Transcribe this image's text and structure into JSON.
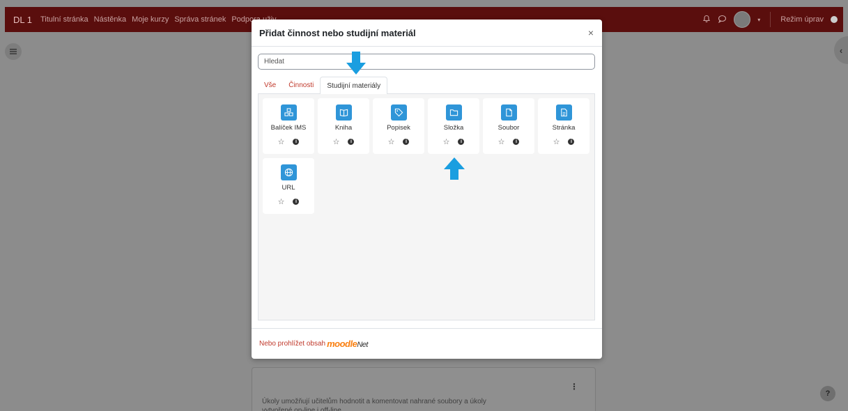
{
  "navbar": {
    "brand": "DL 1",
    "links": [
      "Titulní stránka",
      "Nástěnka",
      "Moje kurzy",
      "Správa stránek",
      "Podpora uživ"
    ],
    "edit_mode_label": "Režim úprav"
  },
  "modal": {
    "title": "Přidat činnost nebo studijní materiál",
    "close": "×",
    "search_placeholder": "Hledat",
    "tabs": [
      "Vše",
      "Činnosti",
      "Studijní materiály"
    ],
    "active_tab": "Studijní materiály",
    "tiles": [
      {
        "label": "Balíček IMS",
        "icon": "package-icon"
      },
      {
        "label": "Kniha",
        "icon": "book-icon"
      },
      {
        "label": "Popisek",
        "icon": "tag-icon"
      },
      {
        "label": "Složka",
        "icon": "folder-icon"
      },
      {
        "label": "Soubor",
        "icon": "file-icon"
      },
      {
        "label": "Stránka",
        "icon": "page-icon"
      },
      {
        "label": "URL",
        "icon": "globe-icon"
      }
    ],
    "footer_text": "Nebo prohlížet obsah",
    "footer_logo_moodle": "moodle",
    "footer_logo_net": "Net"
  },
  "background_card": {
    "text": "Úkoly umožňují učitelům hodnotit a komentovat nahrané soubory a úkoly vytvořené on-line i off-line"
  },
  "colors": {
    "accent": "#2f95d8",
    "navbar": "#5a0e0d",
    "link_red": "#c0392b",
    "moodle_orange": "#f98012"
  }
}
